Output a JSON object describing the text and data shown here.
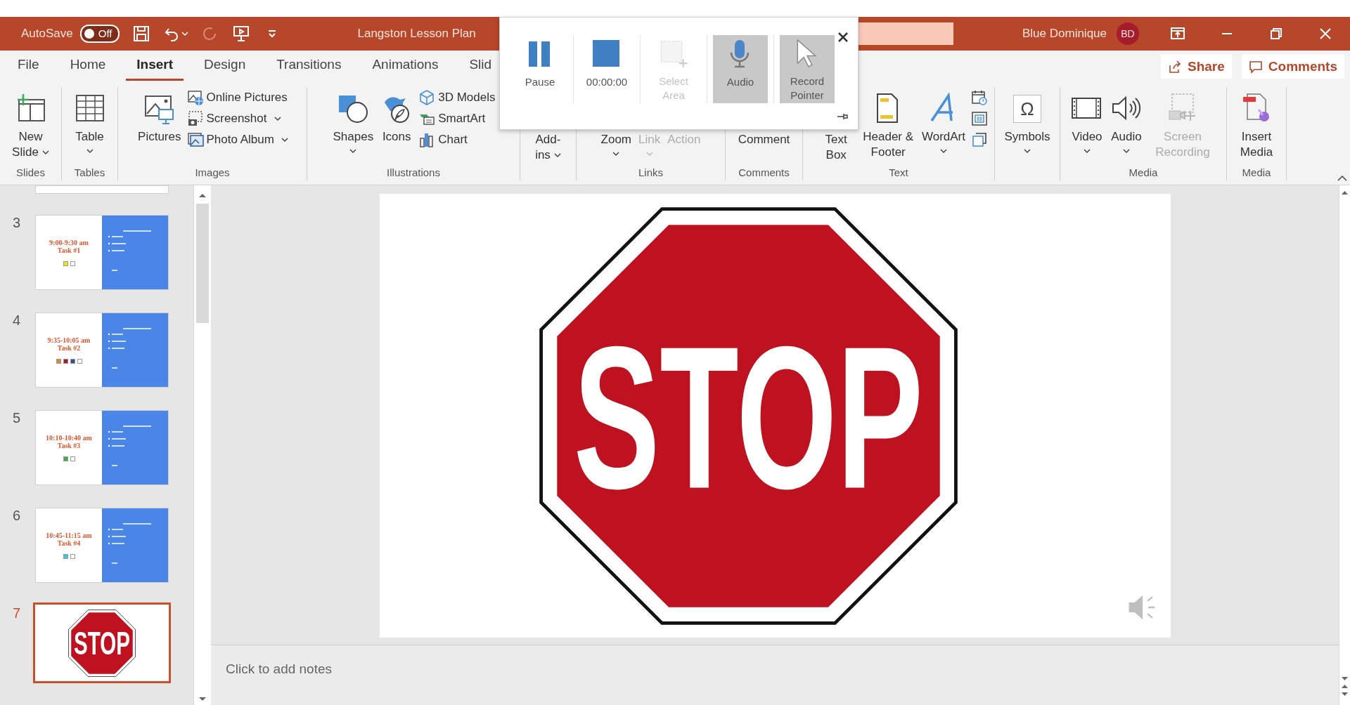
{
  "title_bar": {
    "autosave_label": "AutoSave",
    "autosave": {
      "label": "Off",
      "on": false
    },
    "document_title": "Langston Lesson Plan",
    "user_name": "Blue Dominique",
    "user_initials": "BD"
  },
  "tabs": [
    {
      "label": "File",
      "selected": false
    },
    {
      "label": "Home",
      "selected": false
    },
    {
      "label": "Insert",
      "selected": true
    },
    {
      "label": "Design",
      "selected": false
    },
    {
      "label": "Transitions",
      "selected": false
    },
    {
      "label": "Animations",
      "selected": false
    },
    {
      "label": "Slid",
      "selected": false
    }
  ],
  "share_label": "Share",
  "comments_label": "Comments",
  "ribbon_groups": [
    {
      "label": "Slides",
      "items": [
        {
          "kind": "large",
          "label": "New Slide",
          "dropdown": true,
          "disabled": false
        }
      ]
    },
    {
      "label": "Tables",
      "items": [
        {
          "kind": "large",
          "label": "Table",
          "dropdown": true,
          "disabled": false
        }
      ]
    },
    {
      "label": "Images",
      "items": [
        {
          "kind": "large",
          "label": "Pictures",
          "dropdown": false,
          "disabled": false
        },
        {
          "kind": "small",
          "label": "Online Pictures",
          "dropdown": false,
          "disabled": false
        },
        {
          "kind": "small",
          "label": "Screenshot",
          "dropdown": true,
          "disabled": false
        },
        {
          "kind": "small",
          "label": "Photo Album",
          "dropdown": true,
          "disabled": false
        }
      ]
    },
    {
      "label": "Illustrations",
      "items": [
        {
          "kind": "large",
          "label": "Shapes",
          "dropdown": true,
          "disabled": false
        },
        {
          "kind": "large",
          "label": "Icons",
          "dropdown": false,
          "disabled": false
        },
        {
          "kind": "small",
          "label": "3D Models",
          "dropdown": false,
          "disabled": false
        },
        {
          "kind": "small",
          "label": "SmartArt",
          "dropdown": false,
          "disabled": false
        },
        {
          "kind": "small",
          "label": "Chart",
          "dropdown": false,
          "disabled": false
        }
      ]
    },
    {
      "items": [
        {
          "kind": "large",
          "label": "Add-ins",
          "dropdown": true,
          "disabled": false
        }
      ]
    },
    {
      "label": "Links",
      "items": [
        {
          "kind": "large",
          "label": "Zoom",
          "dropdown": true,
          "disabled": false
        },
        {
          "kind": "large",
          "label": "Link",
          "dropdown": true,
          "disabled": true
        },
        {
          "kind": "large",
          "label": "Action",
          "dropdown": false,
          "disabled": true
        }
      ]
    },
    {
      "label": "Comments",
      "items": [
        {
          "kind": "large",
          "label": "Comment",
          "dropdown": false,
          "disabled": false
        }
      ]
    },
    {
      "label": "Text",
      "items": [
        {
          "kind": "large",
          "label": "Text Box",
          "dropdown": false,
          "disabled": false
        },
        {
          "kind": "large",
          "label": "Header & Footer",
          "dropdown": false,
          "disabled": false
        },
        {
          "kind": "large",
          "label": "WordArt",
          "dropdown": true,
          "disabled": false
        },
        {
          "kind": "icon"
        },
        {
          "kind": "icon"
        },
        {
          "kind": "icon"
        }
      ]
    },
    {
      "items": [
        {
          "kind": "large",
          "label": "Symbols",
          "glyph": "Ω",
          "dropdown": true,
          "disabled": false
        }
      ]
    },
    {
      "label": "Media",
      "items": [
        {
          "kind": "large",
          "label": "Video",
          "dropdown": true,
          "disabled": false
        },
        {
          "kind": "large",
          "label": "Audio",
          "dropdown": true,
          "disabled": false
        },
        {
          "kind": "large",
          "label": "Screen Recording",
          "dropdown": false,
          "disabled": true
        }
      ]
    },
    {
      "label": "Media",
      "items": [
        {
          "kind": "large",
          "label": "Insert Media",
          "dropdown": false,
          "disabled": false
        }
      ]
    }
  ],
  "recorder": {
    "buttons": [
      {
        "kind": "pause",
        "label": "Pause",
        "disabled": false,
        "on": false
      },
      {
        "kind": "stop",
        "label": "00:00:00",
        "disabled": false,
        "on": false
      },
      {
        "kind": "area",
        "label": "Select Area",
        "disabled": true,
        "on": false
      },
      {
        "kind": "audio",
        "label": "Audio",
        "disabled": false,
        "on": true
      },
      {
        "kind": "pointer",
        "label": "Record Pointer",
        "disabled": false,
        "on": true
      }
    ]
  },
  "slides": [
    {
      "kind": "cut",
      "selected": false
    },
    {
      "kind": "task",
      "number": "3",
      "time": "9:00-9:30 am",
      "task": "Task #1",
      "selected": false,
      "swatches": [
        {
          "color": "#f2e21a"
        },
        {
          "color": "#ffffff"
        }
      ]
    },
    {
      "kind": "task",
      "number": "4",
      "time": "9:35-10:05 am",
      "task": "Task #2",
      "selected": false,
      "swatches": [
        {
          "color": "#d4893a"
        },
        {
          "color": "#9c1d2e"
        },
        {
          "color": "#3d4e8e"
        },
        {
          "color": "#ffffff"
        }
      ]
    },
    {
      "kind": "task",
      "number": "5",
      "time": "10:10-10:40 am",
      "task": "Task #3",
      "selected": false,
      "swatches": [
        {
          "color": "#3fae49"
        },
        {
          "color": "#ffffff"
        }
      ]
    },
    {
      "kind": "task",
      "number": "6",
      "time": "10:45-11:15 am",
      "task": "Task #4",
      "selected": false,
      "swatches": [
        {
          "color": "#3ec6e6"
        },
        {
          "color": "#ffffff"
        }
      ]
    },
    {
      "kind": "sign",
      "number": "7",
      "sign_text": "STOP",
      "selected": true
    }
  ],
  "slide": {
    "sign_text": "STOP"
  },
  "notes_placeholder": "Click to add notes"
}
